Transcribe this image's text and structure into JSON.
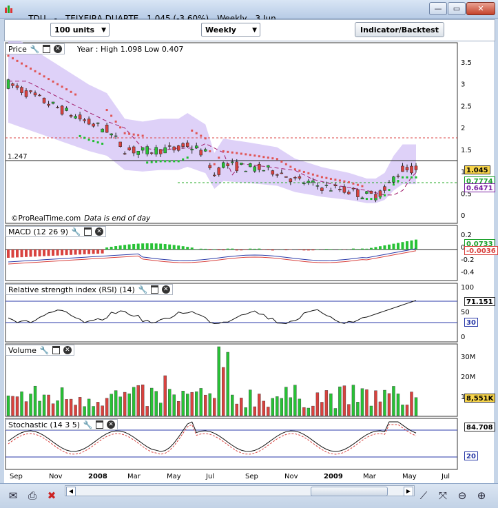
{
  "window": {
    "symbol": "TDU",
    "name": "TEIXEIRA DUARTE",
    "price": "1.045 (-3.60%)",
    "period": "Weekly",
    "date": "3 Jun"
  },
  "toolbar": {
    "units": "100 units",
    "timeframe": "Weekly",
    "indicator_button": "Indicator/Backtest"
  },
  "price_panel": {
    "title": "Price",
    "year_info": "Year : High 1.098 Low 0.407",
    "hline_label": "1.247",
    "axis": [
      "3.5",
      "3",
      "2.5",
      "2",
      "1.5",
      "1",
      "0.5",
      "0"
    ],
    "last_price": "1.045",
    "value_green": "0.7774",
    "value_purple": "0.6471",
    "credit": "©ProRealTime.com",
    "credit_note": "Data is end of day"
  },
  "macd_panel": {
    "title": "MACD (12 26 9)",
    "axis": [
      "0.2",
      "0",
      "-0.2",
      "-0.4"
    ],
    "value_green": "0.0733",
    "value_red": "-0.0036"
  },
  "rsi_panel": {
    "title": "Relative strength index (RSI) (14)",
    "axis": [
      "100",
      "50",
      "0"
    ],
    "value": "71.151",
    "low_level": "30"
  },
  "volume_panel": {
    "title": "Volume",
    "axis": [
      "30M",
      "20M",
      "10M"
    ],
    "value": "8,551K"
  },
  "stoch_panel": {
    "title": "Stochastic (14 3 5)",
    "value": "84.708",
    "low_level": "20"
  },
  "x_axis": [
    "Sep",
    "Nov",
    "2008",
    "Mar",
    "May",
    "Jul",
    "Sep",
    "Nov",
    "2009",
    "Mar",
    "May",
    "Jul"
  ],
  "colors": {
    "up": "#27c235",
    "down": "#d9423e",
    "cloud": "#d8c9f7",
    "sar_up": "#1fbf2f",
    "sar_down": "#e05555"
  },
  "icons": [
    "mail-icon",
    "print-icon",
    "delete-icon",
    "trendline-tool-icon",
    "zoom-fit-icon",
    "zoom-out-icon",
    "zoom-in-icon"
  ]
}
